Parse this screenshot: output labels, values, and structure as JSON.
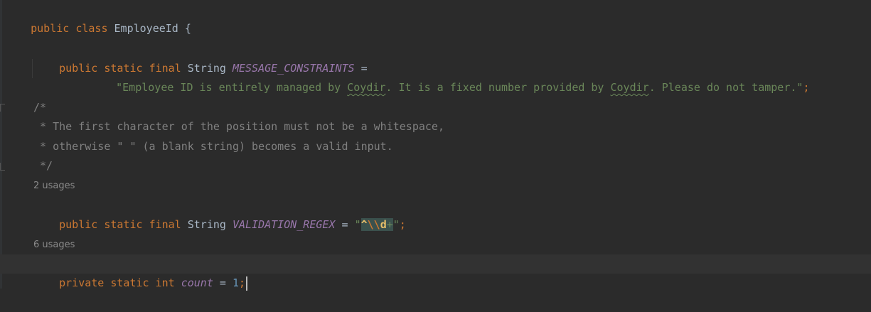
{
  "code": {
    "l1": {
      "kw1": "public",
      "kw2": "class",
      "name": "EmployeeId",
      "brace": "{"
    },
    "l3": {
      "kw1": "public",
      "kw2": "static",
      "kw3": "final",
      "type": "String",
      "const": "MESSAGE_CONSTRAINTS",
      "op": "="
    },
    "l4": {
      "s1": "\"Employee ID is entirely managed by ",
      "w1": "Coydir",
      "s2": ". It is a fixed number provided by ",
      "w2": "Coydir",
      "s3": ". Please do not tamper.\"",
      "semi": ";"
    },
    "l6": {
      "text": "/*"
    },
    "l7": {
      "text": " * The first character of the position must not be a whitespace,"
    },
    "l8": {
      "text": " * otherwise \" \" (a blank string) becomes a valid input."
    },
    "l9": {
      "text": " */"
    },
    "hint1": "2 usages",
    "l11": {
      "kw1": "public",
      "kw2": "static",
      "kw3": "final",
      "type": "String",
      "const": "VALIDATION_REGEX",
      "op": "=",
      "q1": "\"",
      "caret": "^",
      "esc": "\\\\",
      "d": "d",
      "plus": "+",
      "q2": "\"",
      "semi": ";"
    },
    "hint2": "6 usages",
    "l14": {
      "kw1": "private",
      "kw2": "static",
      "kw3": "int",
      "field": "count",
      "op": "=",
      "num": "1",
      "semi": ";"
    }
  },
  "colors": {
    "background": "#2b2b2b",
    "keyword": "#cc7832",
    "constant": "#9876aa",
    "string": "#6a8759",
    "number": "#6897bb",
    "comment": "#808080"
  }
}
